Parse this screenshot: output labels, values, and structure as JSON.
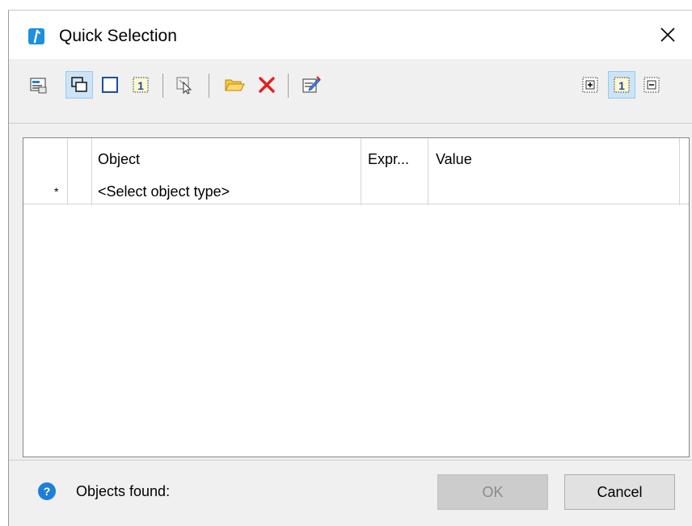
{
  "window": {
    "title": "Quick Selection",
    "close_symbol": "✕"
  },
  "toolbar": {
    "left_buttons": [
      {
        "icon": "select-from-list-icon",
        "pressed": false
      },
      {
        "icon": "select-in-window-icon",
        "pressed": true
      },
      {
        "icon": "select-all-rectangle-icon",
        "pressed": false
      },
      {
        "icon": "single-select-icon",
        "pressed": false
      },
      {
        "icon": "pick-object-icon",
        "pressed": false
      },
      {
        "icon": "open-folder-icon",
        "pressed": false
      },
      {
        "icon": "delete-icon",
        "pressed": false
      },
      {
        "icon": "properties-icon",
        "pressed": false
      }
    ],
    "right_buttons": [
      {
        "icon": "expand-icon",
        "pressed": false
      },
      {
        "icon": "single-mode-icon",
        "pressed": true
      },
      {
        "icon": "collapse-icon",
        "pressed": false
      }
    ],
    "single_glyph": "1"
  },
  "grid": {
    "columns": [
      "",
      "",
      "Object",
      "Expr...",
      "Value"
    ],
    "rows": [
      {
        "marker": "*",
        "flag": "",
        "object": "<Select object type>",
        "expr": "",
        "value": ""
      }
    ]
  },
  "footer": {
    "help_symbol": "?",
    "objects_found_label": "Objects found:",
    "ok_label": "OK",
    "cancel_label": "Cancel"
  },
  "colors": {
    "accent": "#1f7fd8",
    "pressed_bg": "#cce4f7",
    "delete_red": "#e02020",
    "folder_yellow": "#f2c744"
  }
}
